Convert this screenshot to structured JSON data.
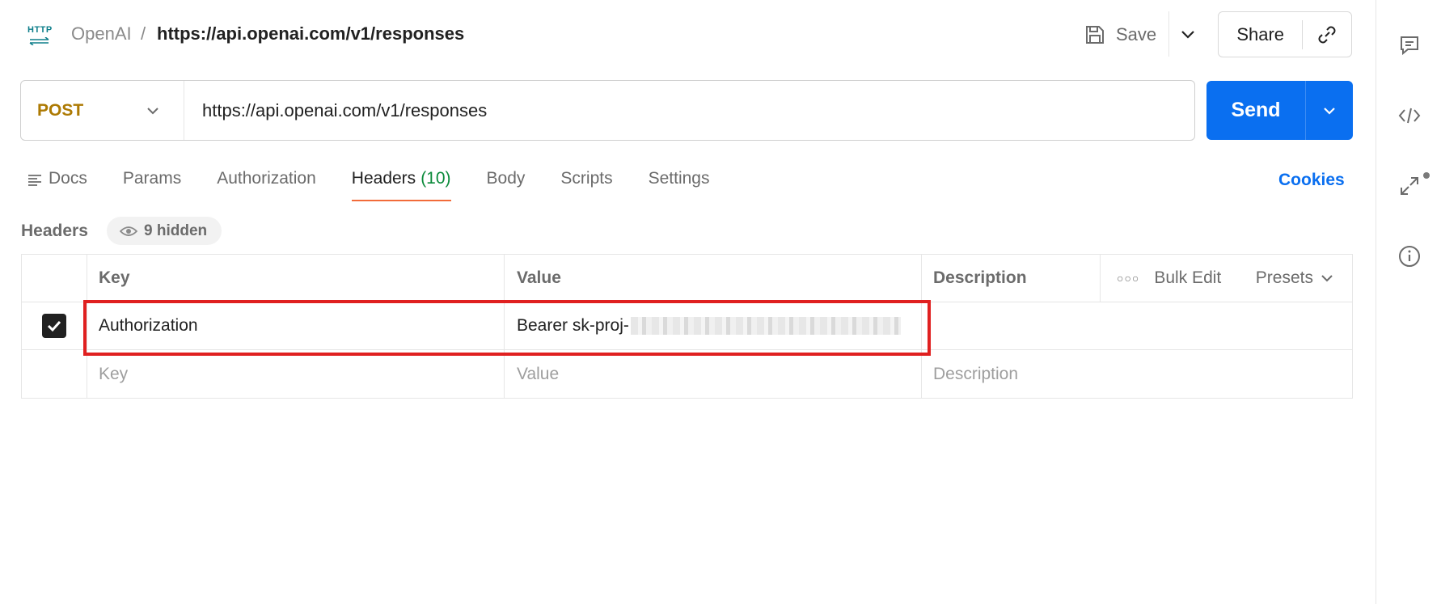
{
  "breadcrumb": {
    "icon_label": "HTTP",
    "parent": "OpenAI",
    "separator": "/",
    "title": "https://api.openai.com/v1/responses"
  },
  "toolbar": {
    "save_label": "Save",
    "share_label": "Share"
  },
  "request": {
    "method": "POST",
    "url": "https://api.openai.com/v1/responses",
    "send_label": "Send"
  },
  "tabs": [
    {
      "label": "Docs"
    },
    {
      "label": "Params"
    },
    {
      "label": "Authorization"
    },
    {
      "label": "Headers",
      "count": "(10)",
      "active": true
    },
    {
      "label": "Body"
    },
    {
      "label": "Scripts"
    },
    {
      "label": "Settings"
    }
  ],
  "cookies_label": "Cookies",
  "headers_section": {
    "title": "Headers",
    "hidden_label": "9 hidden"
  },
  "table": {
    "columns": [
      "Key",
      "Value",
      "Description"
    ],
    "bulk_edit": "Bulk Edit",
    "presets": "Presets",
    "rows": [
      {
        "checked": true,
        "key": "Authorization",
        "value": "Bearer sk-proj-",
        "description": ""
      }
    ],
    "placeholders": {
      "key": "Key",
      "value": "Value",
      "description": "Description"
    }
  },
  "colors": {
    "accent": "#0a6ff0",
    "method": "#ad7a03",
    "active_tab_underline": "#f26b3a",
    "count": "#0a8a3a",
    "highlight": "#e02020"
  },
  "sidebar_icons": [
    "comments-icon",
    "code-icon",
    "related-collections-icon",
    "info-icon"
  ]
}
